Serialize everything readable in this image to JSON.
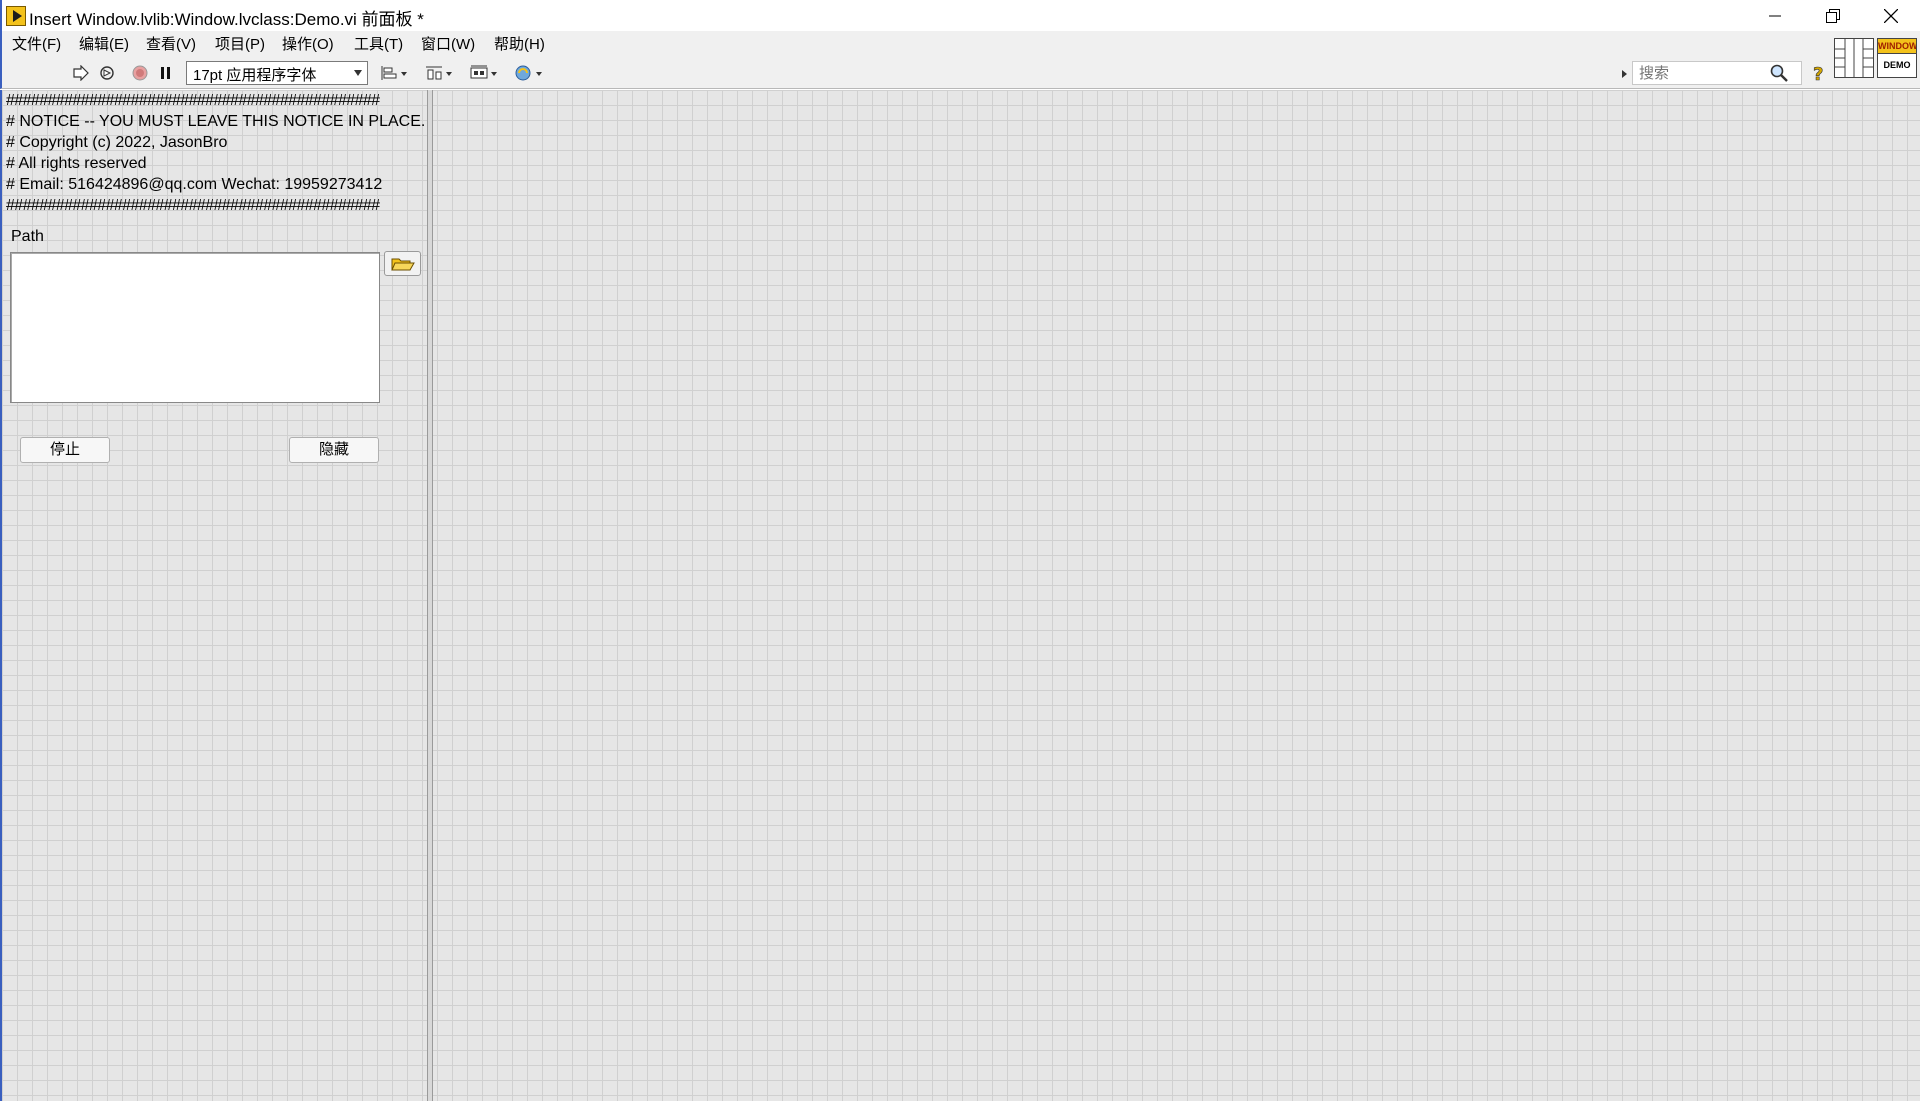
{
  "window": {
    "title": "Insert Window.lvlib:Window.lvclass:Demo.vi 前面板 *"
  },
  "menu": {
    "items": [
      {
        "label": "文件(F)"
      },
      {
        "label": "编辑(E)"
      },
      {
        "label": "查看(V)"
      },
      {
        "label": "项目(P)"
      },
      {
        "label": "操作(O)"
      },
      {
        "label": "工具(T)"
      },
      {
        "label": "窗口(W)"
      },
      {
        "label": "帮助(H)"
      }
    ]
  },
  "toolbar": {
    "font_selector": "17pt 应用程序字体",
    "search_placeholder": "搜索"
  },
  "vi_icon": {
    "top_text": "WINDOW",
    "bottom_text": "DEMO"
  },
  "notice": {
    "lines": [
      "#############################################",
      "# NOTICE -- YOU MUST LEAVE THIS NOTICE IN PLACE.",
      "# Copyright (c) 2022, JasonBro",
      "# All rights reserved",
      "# Email: 516424896@qq.com Wechat: 19959273412",
      "#############################################"
    ]
  },
  "controls": {
    "path_label": "Path",
    "path_value": "",
    "stop_button": "停止",
    "hide_button": "隐藏"
  }
}
